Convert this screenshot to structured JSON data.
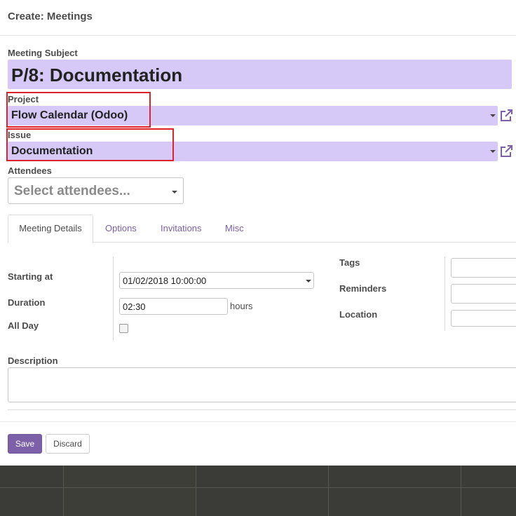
{
  "dialog": {
    "title": "Create: Meetings"
  },
  "form": {
    "meeting_subject": {
      "label": "Meeting Subject",
      "value": "P/8: Documentation"
    },
    "project": {
      "label": "Project",
      "value": "Flow Calendar (Odoo)"
    },
    "issue": {
      "label": "Issue",
      "value": "Documentation"
    },
    "attendees": {
      "label": "Attendees",
      "placeholder": "Select attendees..."
    }
  },
  "tabs": [
    {
      "label": "Meeting Details",
      "active": true
    },
    {
      "label": "Options",
      "active": false
    },
    {
      "label": "Invitations",
      "active": false
    },
    {
      "label": "Misc",
      "active": false
    }
  ],
  "details": {
    "starting_at": {
      "label": "Starting at",
      "value": "01/02/2018 10:00:00"
    },
    "duration": {
      "label": "Duration",
      "value": "02:30",
      "unit": "hours"
    },
    "all_day": {
      "label": "All Day",
      "checked": false
    },
    "tags": {
      "label": "Tags",
      "value": ""
    },
    "reminders": {
      "label": "Reminders",
      "value": ""
    },
    "location": {
      "label": "Location",
      "value": ""
    }
  },
  "description": {
    "label": "Description",
    "value": ""
  },
  "footer": {
    "save_label": "Save",
    "discard_label": "Discard"
  },
  "colors": {
    "accent": "#7c61a8",
    "required_field": "#d6c8f7",
    "highlight_box": "#e0212a"
  }
}
